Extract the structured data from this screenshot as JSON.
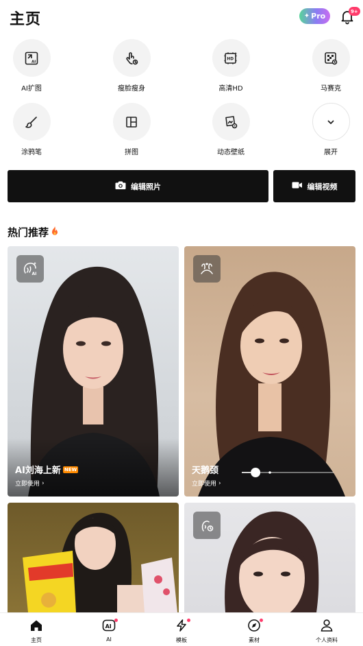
{
  "header": {
    "title": "主页",
    "pro_label": "Pro",
    "notification_count": "9+"
  },
  "tools": [
    {
      "label": "AI扩图",
      "icon": "ai-expand-icon"
    },
    {
      "label": "瘦脸瘦身",
      "icon": "hand-pointer-icon"
    },
    {
      "label": "高清HD",
      "icon": "hd-icon"
    },
    {
      "label": "马赛克",
      "icon": "mosaic-icon"
    },
    {
      "label": "涂鸦笔",
      "icon": "brush-icon"
    },
    {
      "label": "拼图",
      "icon": "collage-icon"
    },
    {
      "label": "动态壁纸",
      "icon": "live-wallpaper-icon"
    },
    {
      "label": "展开",
      "icon": "chevron-down-icon"
    }
  ],
  "edit": {
    "photo_label": "编辑照片",
    "video_label": "编辑视频"
  },
  "section": {
    "title": "热门推荐"
  },
  "cards": [
    {
      "title": "AI刘海上新",
      "new_tag": "NEW",
      "cta": "立即使用"
    },
    {
      "title": "天鹅颈",
      "cta": "立即使用",
      "slider_value": 0.15
    }
  ],
  "nav": [
    {
      "label": "主页",
      "icon": "home-icon",
      "dot": false
    },
    {
      "label": "AI",
      "icon": "ai-icon",
      "dot": true
    },
    {
      "label": "模板",
      "icon": "bolt-icon",
      "dot": true
    },
    {
      "label": "素材",
      "icon": "compass-icon",
      "dot": true
    },
    {
      "label": "个人资料",
      "icon": "person-icon",
      "dot": false
    }
  ],
  "colors": {
    "accent_dark": "#111111",
    "badge_red": "#ff3b6b"
  }
}
